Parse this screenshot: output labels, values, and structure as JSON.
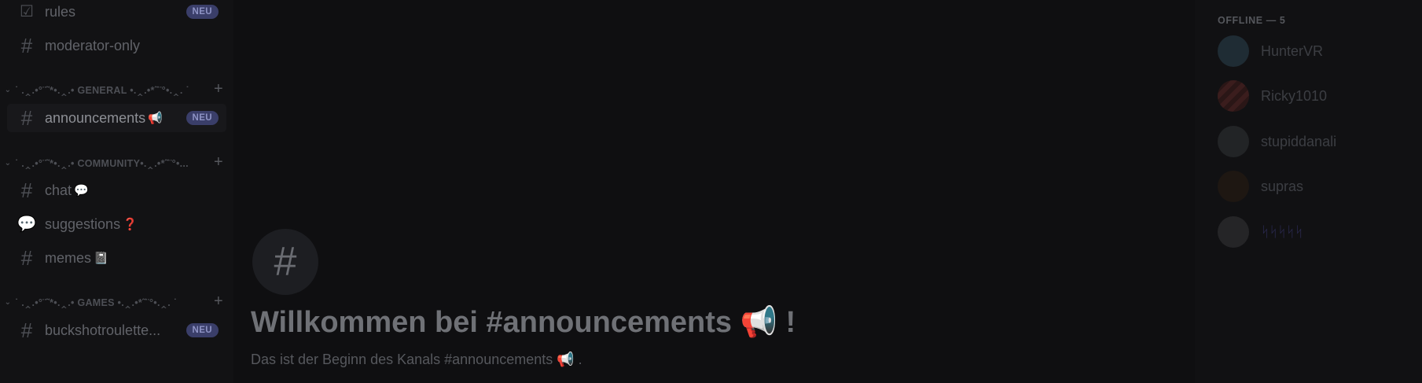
{
  "sidebar": {
    "channels_top": [
      {
        "name": "rules",
        "icon": "rules-icon",
        "badge": "NEU"
      },
      {
        "name": "moderator-only",
        "icon": "locked-hash-icon"
      }
    ],
    "categories": [
      {
        "label": "˙ .‸.•°¨˜*•.‸.• GENERAL •.‸.•*˜¨°•.‸. ˙",
        "channels": [
          {
            "name": "announcements",
            "emoji": "📢",
            "icon": "hash-icon",
            "badge": "NEU",
            "active": true
          }
        ]
      },
      {
        "label": "˙ .‸.•°¨˜*•.‸.• COMMUNITY•.‸.•*˜¨°•...",
        "channels": [
          {
            "name": "chat",
            "emoji": "💬",
            "icon": "hash-icon"
          },
          {
            "name": "suggestions",
            "emoji": "❓",
            "icon": "forum-icon"
          },
          {
            "name": "memes",
            "emoji": "📓",
            "icon": "hash-icon"
          }
        ]
      },
      {
        "label": "˙ .‸.•°¨˜*•.‸.• GAMES •.‸.•*˜¨°•.‸. ˙",
        "channels": [
          {
            "name": "buckshotroulette...",
            "icon": "hash-icon",
            "badge": "NEU"
          }
        ]
      }
    ]
  },
  "main": {
    "hash_symbol": "#",
    "welcome_title": "Willkommen bei #announcements 📢 !",
    "subtitle": "Das ist der Beginn des Kanals #announcements 📢 ."
  },
  "members": {
    "header": "OFFLINE — 5",
    "list": [
      {
        "name": "HunterVR",
        "avatar_color": "#2a3a45"
      },
      {
        "name": "Ricky1010",
        "avatar_color": "#3a1f1f"
      },
      {
        "name": "stupiddanali",
        "avatar_color": "#25282a"
      },
      {
        "name": "supras",
        "avatar_color": "#231a14"
      },
      {
        "name": "ᛋᛋᛋᛋᛋ",
        "avatar_color": "#2a2a2c",
        "colored": true
      }
    ]
  }
}
